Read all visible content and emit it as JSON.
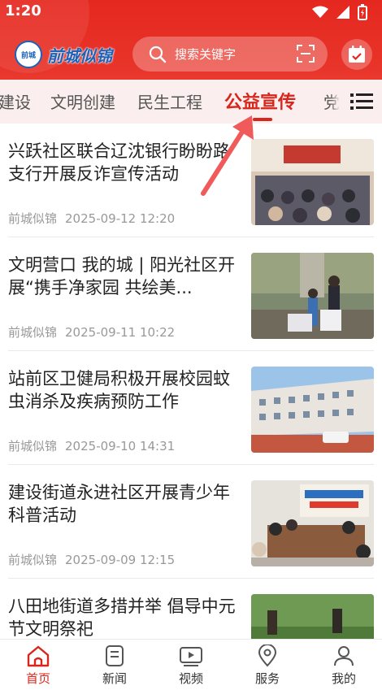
{
  "status": {
    "time": "1:20"
  },
  "header": {
    "logo_badge": "前城",
    "logo_text": "前城似锦",
    "search_placeholder": "搜索关键字"
  },
  "tabs": [
    {
      "label": "建设"
    },
    {
      "label": "文明创建"
    },
    {
      "label": "民生工程"
    },
    {
      "label": "公益宣传",
      "active": true
    },
    {
      "label": "党"
    }
  ],
  "news": [
    {
      "title": "兴跃社区联合辽沈银行盼盼路支行开展反诈宣传活动",
      "source": "前城似锦",
      "time": "2025-09-12 12:20"
    },
    {
      "title": "文明营口 我的城 | 阳光社区开展“携手净家园 共绘美...",
      "source": "前城似锦",
      "time": "2025-09-11 10:22"
    },
    {
      "title": "站前区卫健局积极开展校园蚊虫消杀及疾病预防工作",
      "source": "前城似锦",
      "time": "2025-09-10 14:31"
    },
    {
      "title": "建设街道永进社区开展青少年科普活动",
      "source": "前城似锦",
      "time": "2025-09-09 12:15"
    },
    {
      "title": "八田地街道多措并举 倡导中元节文明祭祀",
      "source": "",
      "time": ""
    }
  ],
  "bottom_nav": [
    {
      "label": "首页",
      "icon": "home-icon",
      "active": true
    },
    {
      "label": "新闻",
      "icon": "news-icon"
    },
    {
      "label": "视频",
      "icon": "video-icon"
    },
    {
      "label": "服务",
      "icon": "location-icon"
    },
    {
      "label": "我的",
      "icon": "user-icon"
    }
  ],
  "colors": {
    "brand_red": "#d8261c",
    "header_red": "#e5281f",
    "tab_bg": "#fbeeee"
  }
}
